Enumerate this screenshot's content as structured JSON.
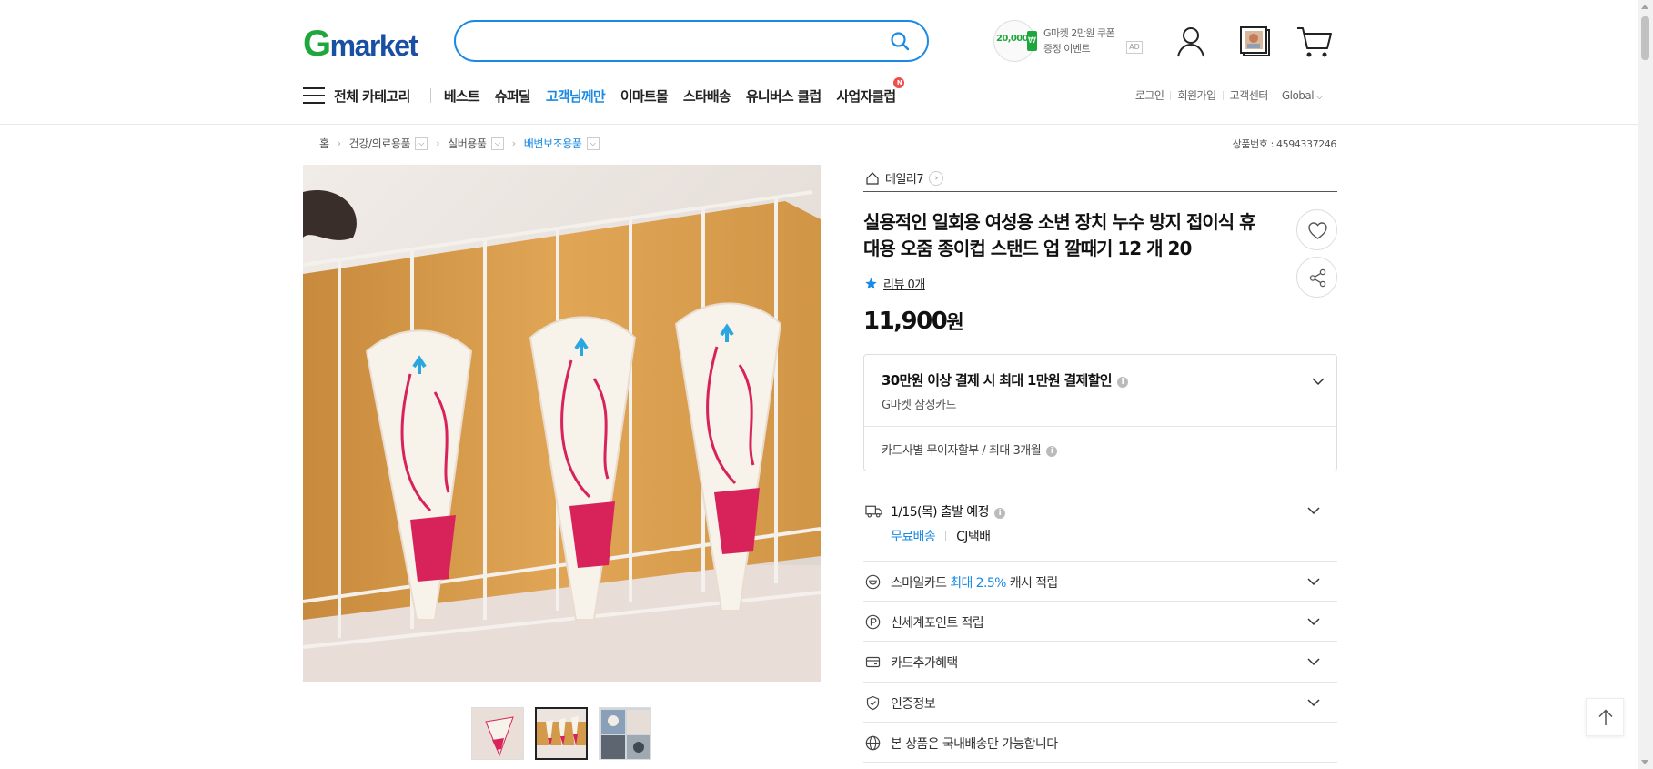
{
  "header": {
    "logo": {
      "g": "G",
      "rest": "market"
    },
    "search": {
      "value": "",
      "placeholder": ""
    },
    "coupon": {
      "amount": "20,000",
      "line1": "G마켓 2만원 쿠폰",
      "line2": "증정 이벤트",
      "ad": "AD"
    },
    "icons": [
      "user-icon",
      "recent-items-icon",
      "cart-icon"
    ]
  },
  "nav": {
    "all_categories": "전체 카테고리",
    "items": [
      "베스트",
      "슈퍼딜",
      "고객님께만",
      "이마트몰",
      "스타배송",
      "유니버스 클럽",
      "사업자클럽"
    ],
    "highlight_color": "#1a8ae5",
    "new_badge": "N"
  },
  "util": {
    "login": "로그인",
    "signup": "회원가입",
    "support": "고객센터",
    "global": "Global"
  },
  "breadcrumb": {
    "items": [
      "홈",
      "건강/의료용품",
      "실버용품",
      "배변보조용품"
    ],
    "product_number": "상품번호 : 4594337246"
  },
  "product": {
    "seller": "데일리7",
    "title": "실용적인 일회용 여성용 소변 장치 누수 방지 접이식 휴대용 오줌 종이컵 스탠드 업 깔때기 12 개 20",
    "review": "리뷰 0개",
    "price": "11,900",
    "price_unit": "원",
    "card": {
      "headline": "30만원 이상 결제 시 최대 1만원 결제할인",
      "card_name": "G마켓 삼성카드",
      "installment": "카드사별 무이자할부 / 최대 3개월"
    },
    "shipping": {
      "date": "1/15(목) 출발 예정",
      "fee": "무료배송",
      "courier": "CJ택배"
    },
    "benefits": {
      "smilecard_prefix": "스마일카드",
      "smilecard_highlight": "최대 2.5%",
      "smilecard_suffix": "캐시 적립",
      "shinsegae": "신세계포인트 적립",
      "card_extra": "카드추가혜택",
      "certification": "인증정보",
      "domestic": "본 상품은 국내배송만 가능합니다"
    }
  },
  "colors": {
    "brand_green": "#1ea73c",
    "brand_blue": "#1a4fa3",
    "accent": "#1a8ae5",
    "product_pink": "#d8235a"
  }
}
